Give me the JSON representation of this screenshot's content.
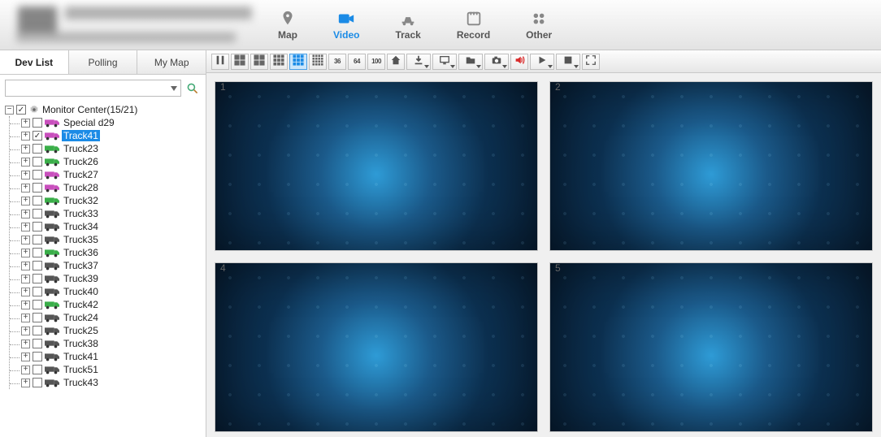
{
  "nav": {
    "map": "Map",
    "video": "Video",
    "track": "Track",
    "record": "Record",
    "other": "Other"
  },
  "sidebar": {
    "tabs": {
      "dev_list": "Dev List",
      "polling": "Polling",
      "my_map": "My Map"
    },
    "search_placeholder": "",
    "root_label": "Monitor Center(15/21)",
    "items": [
      {
        "label": "Special d29",
        "selected": false,
        "checked": false,
        "color": "#c94fbd"
      },
      {
        "label": "Track41",
        "selected": true,
        "checked": true,
        "color": "#c94fbd"
      },
      {
        "label": "Truck23",
        "selected": false,
        "checked": false,
        "color": "#3aae49"
      },
      {
        "label": "Truck26",
        "selected": false,
        "checked": false,
        "color": "#3aae49"
      },
      {
        "label": "Truck27",
        "selected": false,
        "checked": false,
        "color": "#c94fbd"
      },
      {
        "label": "Truck28",
        "selected": false,
        "checked": false,
        "color": "#c94fbd"
      },
      {
        "label": "Truck32",
        "selected": false,
        "checked": false,
        "color": "#3aae49"
      },
      {
        "label": "Truck33",
        "selected": false,
        "checked": false,
        "color": "#555555"
      },
      {
        "label": "Truck34",
        "selected": false,
        "checked": false,
        "color": "#555555"
      },
      {
        "label": "Truck35",
        "selected": false,
        "checked": false,
        "color": "#555555"
      },
      {
        "label": "Truck36",
        "selected": false,
        "checked": false,
        "color": "#3aae49"
      },
      {
        "label": "Truck37",
        "selected": false,
        "checked": false,
        "color": "#555555"
      },
      {
        "label": "Truck39",
        "selected": false,
        "checked": false,
        "color": "#555555"
      },
      {
        "label": "Truck40",
        "selected": false,
        "checked": false,
        "color": "#555555"
      },
      {
        "label": "Truck42",
        "selected": false,
        "checked": false,
        "color": "#3aae49"
      },
      {
        "label": "Truck24",
        "selected": false,
        "checked": false,
        "color": "#555555"
      },
      {
        "label": "Truck25",
        "selected": false,
        "checked": false,
        "color": "#555555"
      },
      {
        "label": "Truck38",
        "selected": false,
        "checked": false,
        "color": "#555555"
      },
      {
        "label": "Truck41",
        "selected": false,
        "checked": false,
        "color": "#555555"
      },
      {
        "label": "Truck51",
        "selected": false,
        "checked": false,
        "color": "#555555"
      },
      {
        "label": "Truck43",
        "selected": false,
        "checked": false,
        "color": "#555555"
      }
    ]
  },
  "toolbar": {
    "buttons": [
      {
        "name": "pause",
        "kind": "pause"
      },
      {
        "name": "grid-2x2",
        "kind": "grid",
        "cells": 4
      },
      {
        "name": "grid-1-5",
        "kind": "grid",
        "cells": 6
      },
      {
        "name": "grid-1-7",
        "kind": "grid",
        "cells": 8
      },
      {
        "name": "grid-3x3",
        "kind": "grid",
        "cells": 9,
        "active": true
      },
      {
        "name": "grid-4x4",
        "kind": "grid",
        "cells": 16
      },
      {
        "name": "grid-36",
        "kind": "text",
        "text": "36"
      },
      {
        "name": "grid-64",
        "kind": "text",
        "text": "64"
      },
      {
        "name": "grid-100",
        "kind": "text",
        "text": "100"
      },
      {
        "name": "home",
        "kind": "home"
      },
      {
        "name": "download",
        "kind": "download",
        "dropdown": true
      },
      {
        "name": "monitor",
        "kind": "monitor",
        "dropdown": true
      },
      {
        "name": "folder",
        "kind": "folder",
        "dropdown": true
      },
      {
        "name": "camera",
        "kind": "camera",
        "dropdown": true
      },
      {
        "name": "sound",
        "kind": "sound",
        "red": true
      },
      {
        "name": "play",
        "kind": "play",
        "dropdown": true
      },
      {
        "name": "stop",
        "kind": "stop",
        "dropdown": true
      },
      {
        "name": "fullscreen",
        "kind": "fullscreen"
      }
    ]
  },
  "video": {
    "tiles": [
      {
        "num": "1"
      },
      {
        "num": "2"
      },
      {
        "num": "4"
      },
      {
        "num": "5"
      }
    ]
  }
}
